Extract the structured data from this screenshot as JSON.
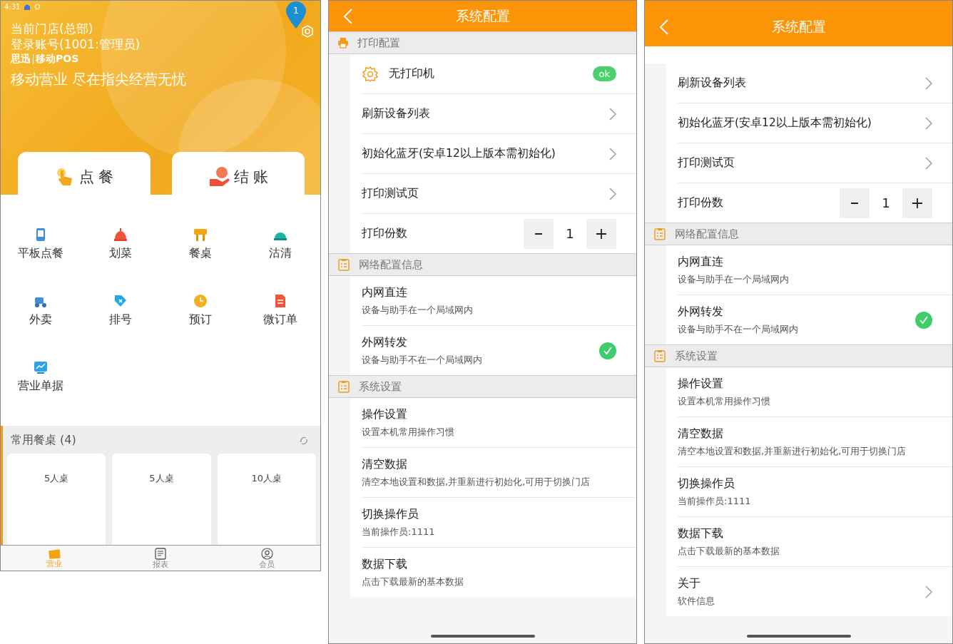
{
  "home": {
    "status_time": "4:31",
    "badge": "1",
    "store": "当前门店(总部)",
    "account": "登录账号(1001:管理员)",
    "brand": "思迅",
    "brand_sub": "移动POS",
    "slogan": "移动营业 尽在指尖经营无忧",
    "big_actions": [
      "点 餐",
      "结 账"
    ],
    "functions": [
      "平板点餐",
      "划菜",
      "餐桌",
      "沽清",
      "外卖",
      "排号",
      "预订",
      "微订单",
      "营业单据"
    ],
    "favorites": {
      "title": "常用餐桌 (4)",
      "tables": [
        "5人桌",
        "5人桌",
        "10人桌"
      ]
    },
    "nav": [
      {
        "label": "营业",
        "selected": true
      },
      {
        "label": "报表",
        "selected": false
      },
      {
        "label": "会员",
        "selected": false
      }
    ]
  },
  "screens": [
    {
      "title": "系统配置",
      "sections": [
        {
          "title": "打印配置",
          "kind": "printer",
          "rows": [
            {
              "kind": "printer",
              "label": "无打印机",
              "status": "ok"
            },
            {
              "kind": "link",
              "label": "刷新设备列表"
            },
            {
              "kind": "link",
              "label": "初始化蓝牙(安卓12以上版本需初始化)"
            },
            {
              "kind": "link",
              "label": "打印测试页"
            },
            {
              "kind": "stepper",
              "label": "打印份数",
              "value": "1"
            }
          ]
        },
        {
          "title": "网络配置信息",
          "rows": [
            {
              "kind": "option",
              "label": "内网直连",
              "sub": "设备与助手在一个局域网内",
              "checked": false
            },
            {
              "kind": "option",
              "label": "外网转发",
              "sub": "设备与助手不在一个局域网内",
              "checked": true
            }
          ]
        },
        {
          "title": "系统设置",
          "rows": [
            {
              "kind": "info",
              "label": "操作设置",
              "sub": "设置本机常用操作习惯"
            },
            {
              "kind": "info",
              "label": "清空数据",
              "sub": "清空本地设置和数据,并重新进行初始化,可用于切换门店"
            },
            {
              "kind": "info",
              "label": "切换操作员",
              "sub": "当前操作员:1111"
            },
            {
              "kind": "info",
              "label": "数据下载",
              "sub": "点击下载最新的基本数据"
            }
          ]
        }
      ]
    },
    {
      "title": "系统配置",
      "sections": [
        {
          "rows": [
            {
              "kind": "link",
              "label": "刷新设备列表"
            },
            {
              "kind": "link",
              "label": "初始化蓝牙(安卓12以上版本需初始化)"
            },
            {
              "kind": "link",
              "label": "打印测试页"
            },
            {
              "kind": "stepper",
              "label": "打印份数",
              "value": "1"
            }
          ]
        },
        {
          "title": "网络配置信息",
          "rows": [
            {
              "kind": "option",
              "label": "内网直连",
              "sub": "设备与助手在一个局域网内",
              "checked": false
            },
            {
              "kind": "option",
              "label": "外网转发",
              "sub": "设备与助手不在一个局域网内",
              "checked": true
            }
          ]
        },
        {
          "title": "系统设置",
          "rows": [
            {
              "kind": "info",
              "label": "操作设置",
              "sub": "设置本机常用操作习惯"
            },
            {
              "kind": "info",
              "label": "清空数据",
              "sub": "清空本地设置和数据,并重新进行初始化,可用于切换门店"
            },
            {
              "kind": "info",
              "label": "切换操作员",
              "sub": "当前操作员:1111"
            },
            {
              "kind": "info",
              "label": "数据下载",
              "sub": "点击下载最新的基本数据"
            },
            {
              "kind": "link",
              "label": "关于",
              "sub": "软件信息"
            }
          ]
        }
      ]
    }
  ]
}
